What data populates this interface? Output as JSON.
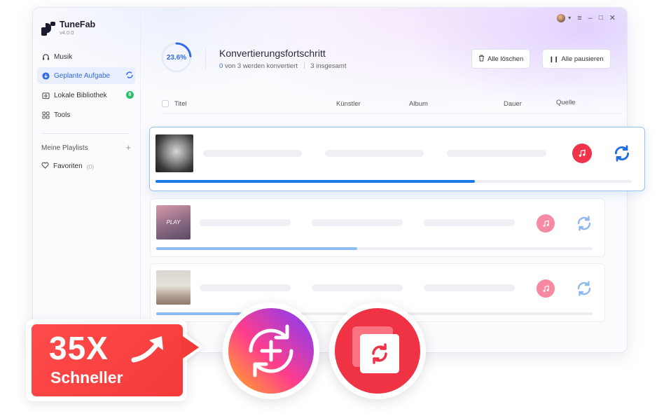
{
  "app": {
    "name": "TuneFab",
    "version": "v4.0.0"
  },
  "sidebar": {
    "items": [
      {
        "label": "Musik",
        "icon": "headphones-icon"
      },
      {
        "label": "Geplante Aufgabe",
        "icon": "download-icon",
        "active": true
      },
      {
        "label": "Lokale Bibliothek",
        "icon": "library-icon",
        "badge": "8"
      },
      {
        "label": "Tools",
        "icon": "grid-icon"
      }
    ],
    "playlists_label": "Meine Playlists",
    "favorites_label": "Favoriten",
    "favorites_count": "(0)"
  },
  "progress": {
    "percent_label": "23.6%",
    "percent": 23.6,
    "title": "Konvertierungsfortschritt",
    "converting_num": "0",
    "converting_text": "von 3 werden konvertiert",
    "total_text": "3 insgesamt"
  },
  "toolbar": {
    "clear_all": "Alle löschen",
    "pause_all": "Alle pausieren"
  },
  "table": {
    "columns": [
      "Titel",
      "Künstler",
      "Album",
      "Dauer",
      "Quelle"
    ]
  },
  "rows": [
    {
      "progress": 0.67,
      "source": "apple-music-icon",
      "selected": true
    },
    {
      "progress": 0.46,
      "source": "apple-music-icon",
      "cover_text": "PLAY"
    },
    {
      "progress": 0.21,
      "source": "apple-music-icon"
    }
  ],
  "promo": {
    "speed": "35X",
    "caption": "Schneller"
  },
  "colors": {
    "accent": "#2f6be6",
    "music_red": "#f0334a",
    "promo_red": "#f43a3a"
  }
}
